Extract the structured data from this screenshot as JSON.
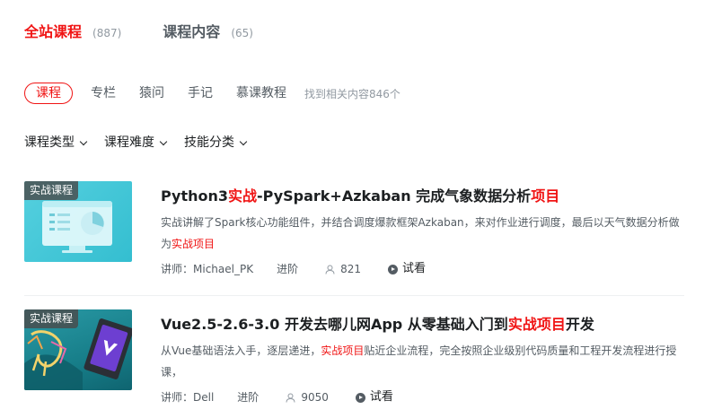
{
  "top_tabs": [
    {
      "label": "全站课程",
      "count": "(887)"
    },
    {
      "label": "课程内容",
      "count": "(65)"
    }
  ],
  "filters": {
    "pills": [
      "课程",
      "专栏",
      "猿问",
      "手记",
      "慕课教程"
    ],
    "result_text": "找到相关内容846个"
  },
  "dropdowns": [
    "课程类型",
    "课程难度",
    "技能分类"
  ],
  "courses": [
    {
      "badge": "实战课程",
      "title_pre": "Python3",
      "title_hl1": "实战",
      "title_mid": "-PySpark+Azkaban 完成气象数据分析",
      "title_hl2": "项目",
      "title_post": "",
      "desc_pre": "实战讲解了Spark核心功能组件，并结合调度爆款框架Azkaban，来对作业进行调度，最后以天气数据分析做为",
      "desc_hl": "实战项目",
      "desc_post": "",
      "instructor": "讲师：Michael_PK",
      "level": "进阶",
      "students": "821",
      "try": "试看"
    },
    {
      "badge": "实战课程",
      "title_pre": "Vue2.5-2.6-3.0 开发去哪儿网App 从零基础入门到",
      "title_hl1": "实战项目",
      "title_mid": "开发",
      "title_hl2": "",
      "title_post": "",
      "desc_pre": "从Vue基础语法入手，逐层递进，",
      "desc_hl": "实战项目",
      "desc_post": "贴近企业流程，完全按照企业级别代码质量和工程开发流程进行授课，",
      "instructor": "讲师：Dell",
      "level": "进阶",
      "students": "9050",
      "try": "试看"
    }
  ],
  "colors": {
    "accent": "#f01414",
    "text": "#1c1f21",
    "muted": "#545c63",
    "light": "#9199a1"
  }
}
